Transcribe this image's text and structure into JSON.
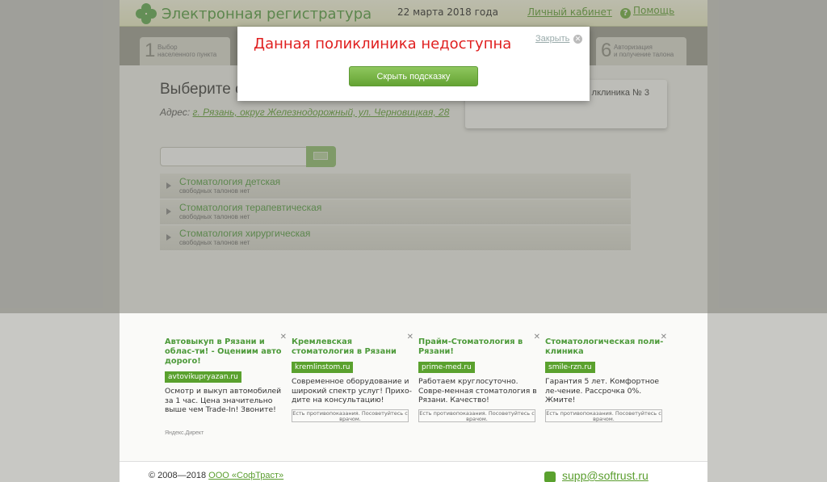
{
  "header": {
    "brand": "Электронная регистратура",
    "date": "22 марта 2018 года",
    "cabinet": "Личный кабинет",
    "help": "Помощь"
  },
  "steps": [
    {
      "num": "1",
      "label": "Выбор\nнаселенного пункта"
    },
    {
      "num": "6",
      "label": "Авторизация\nи получение талона"
    }
  ],
  "main": {
    "heading": "Выберите с",
    "address_label": "Адрес:",
    "address_link": "г. Рязань, округ Железнодорожный, ул. Черновицкая, 28",
    "clinic_chip": "лклиника № 3",
    "search": {
      "value": "",
      "placeholder": ""
    },
    "specialties": [
      {
        "name": "Стоматология детская",
        "status": "свободных талонов нет"
      },
      {
        "name": "Стоматология терапевтическая",
        "status": "свободных талонов нет"
      },
      {
        "name": "Стоматология хирургическая",
        "status": "свободных талонов нет"
      }
    ]
  },
  "modal": {
    "title": "Данная поликлиника недоступна",
    "close": "Закрыть",
    "button": "Скрыть подсказку"
  },
  "ads": {
    "items": [
      {
        "head": "Автовыкуп в Рязани и облас-ти! - Оцениим авто дорого!",
        "domain": "avtovikupryazan.ru",
        "body": "Осмотр и выкуп автомобилей за 1 час. Цена значительно выше чем Trade-In! Звоните!",
        "warning": ""
      },
      {
        "head": "Кремлевская стоматология в Рязани",
        "domain": "kremlinstom.ru",
        "body": "Современное оборудование и широкий спектр услуг! Прихо-дите на консультацию!",
        "warning": "Есть противопоказания. Посоветуйтесь с врачом."
      },
      {
        "head": "Прайм-Стоматология в Рязани!",
        "domain": "prime-med.ru",
        "body": "Работаем круглосуточно. Совре-менная стоматология в Рязани. Качество!",
        "warning": "Есть противопоказания. Посоветуйтесь с врачом."
      },
      {
        "head": "Стоматологическая поли-клиника",
        "domain": "smile-rzn.ru",
        "body": "Гарантия 5 лет. Комфортное ле-чение. Рассрочка 0%. Жмите!",
        "warning": "Есть противопоказания. Посоветуйтесь с врачом."
      }
    ],
    "yandex": "Яндекс.Директ"
  },
  "footer": {
    "copyright": "© 2008—2018",
    "company": "ООО «СофТраст»",
    "email": "supp@softrust.ru"
  },
  "colors": {
    "brand_green": "#4d9a3a",
    "error_red": "#e02020"
  }
}
